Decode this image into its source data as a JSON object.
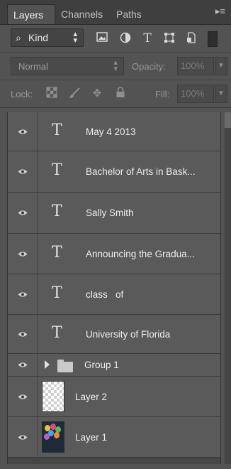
{
  "tabs": [
    {
      "label": "Layers"
    },
    {
      "label": "Channels"
    },
    {
      "label": "Paths"
    }
  ],
  "panel_menu_icon": "panel-menu-icon",
  "filter": {
    "search_icon": "search-icon",
    "kind_label": "Kind",
    "icons": [
      "image-filter-icon",
      "adjustment-filter-icon",
      "type-filter-icon",
      "shape-filter-icon",
      "smart-object-filter-icon"
    ]
  },
  "blend": {
    "mode": "Normal",
    "opacity_label": "Opacity:",
    "opacity_value": "100%"
  },
  "lock": {
    "label": "Lock:",
    "icons": [
      "lock-transparent-pixels-icon",
      "lock-image-pixels-icon",
      "lock-position-icon",
      "lock-all-icon"
    ],
    "fill_label": "Fill:",
    "fill_value": "100%"
  },
  "type_glyph": "T",
  "layers": [
    {
      "kind": "text",
      "name": "May 4 2013"
    },
    {
      "kind": "text",
      "name": "Bachelor of Arts in Bask..."
    },
    {
      "kind": "text",
      "name": "Sally Smith"
    },
    {
      "kind": "text",
      "name": "Announcing the Gradua..."
    },
    {
      "kind": "text",
      "name": "class   of"
    },
    {
      "kind": "text",
      "name": "University of Florida"
    },
    {
      "kind": "group",
      "name": "Group 1"
    },
    {
      "kind": "raster",
      "name": "Layer 2"
    },
    {
      "kind": "raster",
      "name": "Layer 1"
    }
  ],
  "colors": {
    "panel_bg": "#535353",
    "row_bg": "#5a5a5a",
    "text": "#ededed"
  }
}
